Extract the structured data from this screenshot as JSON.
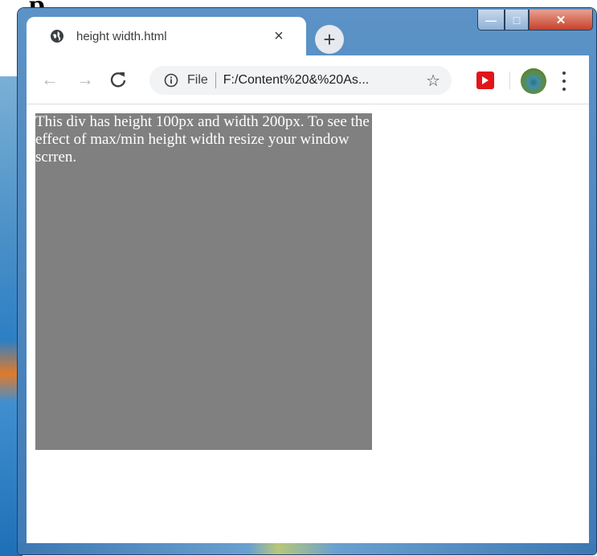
{
  "header_fragment": "p",
  "window_controls": {
    "minimize_label": "—",
    "maximize_label": "□",
    "close_label": "✕"
  },
  "tab": {
    "title": "height width.html",
    "favicon": "globe-icon",
    "close_label": "×"
  },
  "new_tab_label": "+",
  "toolbar": {
    "back_label": "←",
    "forward_label": "→",
    "reload_label": "C",
    "scheme_label": "File",
    "url": "F:/Content%20&%20As...",
    "star_label": "☆"
  },
  "page": {
    "demo_text": "This div has height 100px and width 200px. To see the effect of max/min height width resize your window scrren.",
    "demo_bg_color": "#808080",
    "demo_text_color": "#ffffff"
  },
  "colors": {
    "titlebar": "#3f7bb7",
    "close_button": "#c7412a",
    "extension_red": "#e0161b"
  }
}
